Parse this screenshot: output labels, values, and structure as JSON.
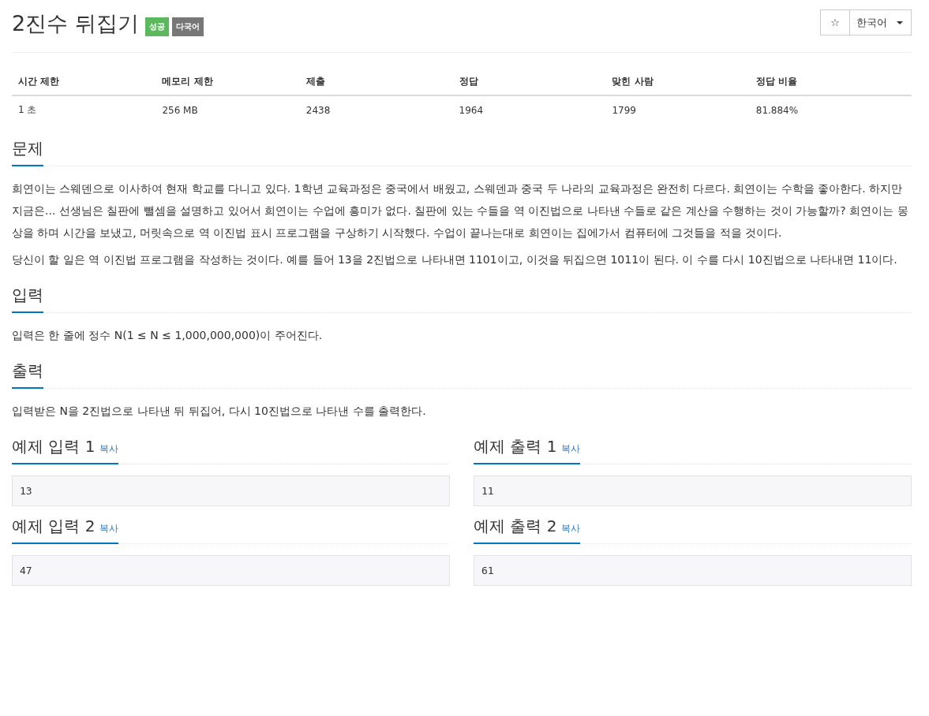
{
  "title": "2진수 뒤집기",
  "badges": [
    {
      "label": "성공",
      "kind": "success"
    },
    {
      "label": "다국어",
      "kind": "language"
    }
  ],
  "favorite": {
    "label": "☆"
  },
  "language_select": {
    "label": "한국어"
  },
  "stats": {
    "columns": [
      "시간 제한",
      "메모리 제한",
      "제출",
      "정답",
      "맞힌 사람",
      "정답 비율"
    ],
    "rows": [
      [
        "1 초",
        "256 MB",
        "2438",
        "1964",
        "1799",
        "81.884%"
      ]
    ]
  },
  "sections": [
    {
      "heading": "문제",
      "paragraphs": [
        "희연이는 스웨덴으로 이사하여 현재 학교를 다니고 있다. 1학년 교육과정은 중국에서 배웠고, 스웨덴과 중국 두 나라의 교육과정은 완전히 다르다. 희연이는 수학을 좋아한다. 하지만 지금은... 선생님은 칠판에 뺄셈을 설명하고 있어서 희연이는 수업에 흥미가 없다. 칠판에 있는 수들을 역 이진법으로 나타낸 수들로 같은 계산을 수행하는 것이 가능할까? 희연이는 몽상을 하며 시간을 보냈고, 머릿속으로 역 이진법 표시 프로그램을 구상하기 시작했다. 수업이 끝나는대로 희연이는 집에가서 컴퓨터에 그것들을 적을 것이다.",
        "당신이 할 일은 역 이진법 프로그램을 작성하는 것이다. 예를 들어 13을 2진법으로 나타내면 1101이고, 이것을 뒤집으면 1011이 된다. 이 수를 다시 10진법으로 나타내면 11이다."
      ]
    },
    {
      "heading": "입력",
      "paragraphs": [
        "입력은 한 줄에 정수 N(1 ≤ N ≤ 1,000,000,000)이 주어진다."
      ]
    },
    {
      "heading": "출력",
      "paragraphs": [
        "입력받은 N을 2진법으로 나타낸 뒤 뒤집어, 다시 10진법으로 나타낸 수를 출력한다."
      ]
    }
  ],
  "samples": [
    {
      "heading": "예제 입력 1",
      "copy": "복사",
      "value": "13"
    },
    {
      "heading": "예제 출력 1",
      "copy": "복사",
      "value": "11"
    },
    {
      "heading": "예제 입력 2",
      "copy": "복사",
      "value": "47"
    },
    {
      "heading": "예제 출력 2",
      "copy": "복사",
      "value": "61"
    }
  ]
}
